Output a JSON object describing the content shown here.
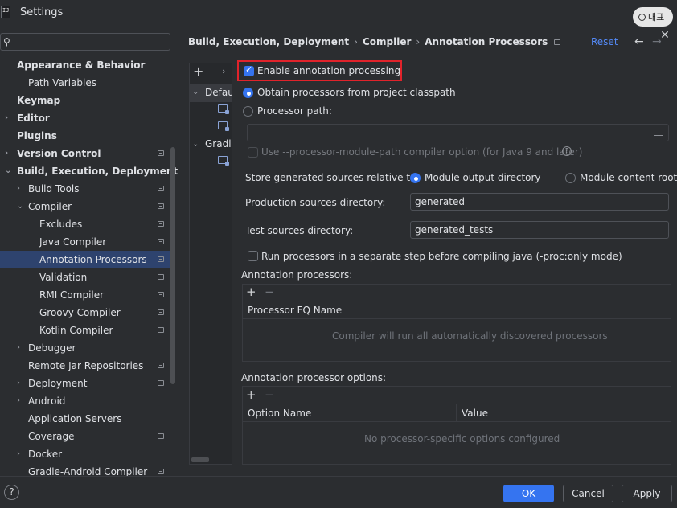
{
  "window": {
    "title": "Settings",
    "ime_label": "대표"
  },
  "sidebar": {
    "search_placeholder": "",
    "items": [
      {
        "label": "Appearance & Behavior",
        "bold": true,
        "expanded": true
      },
      {
        "label": "Path Variables"
      },
      {
        "label": "Keymap",
        "bold": true
      },
      {
        "label": "Editor",
        "bold": true
      },
      {
        "label": "Plugins",
        "bold": true
      },
      {
        "label": "Version Control",
        "bold": true
      },
      {
        "label": "Build, Execution, Deployment",
        "bold": true,
        "expanded": true
      },
      {
        "label": "Build Tools"
      },
      {
        "label": "Compiler",
        "expanded": true
      },
      {
        "label": "Excludes"
      },
      {
        "label": "Java Compiler"
      },
      {
        "label": "Annotation Processors",
        "selected": true
      },
      {
        "label": "Validation"
      },
      {
        "label": "RMI Compiler"
      },
      {
        "label": "Groovy Compiler"
      },
      {
        "label": "Kotlin Compiler"
      },
      {
        "label": "Debugger"
      },
      {
        "label": "Remote Jar Repositories"
      },
      {
        "label": "Deployment"
      },
      {
        "label": "Android"
      },
      {
        "label": "Application Servers"
      },
      {
        "label": "Coverage"
      },
      {
        "label": "Docker"
      },
      {
        "label": "Gradle-Android Compiler"
      }
    ]
  },
  "breadcrumb": {
    "part1": "Build, Execution, Deployment",
    "part2": "Compiler",
    "part3": "Annotation Processors"
  },
  "header": {
    "reset_label": "Reset"
  },
  "profiles": {
    "default_label": "Default",
    "gradle_label": "Gradle"
  },
  "form": {
    "enable_label": "Enable annotation processing",
    "enable_checked": true,
    "obtain_label": "Obtain processors from project classpath",
    "path_label": "Processor path:",
    "path_value": "",
    "module_path_label": "Use --processor-module-path compiler option (for Java 9 and later)",
    "store_label": "Store generated sources relative to:",
    "module_output_label": "Module output directory",
    "module_content_label": "Module content root",
    "prod_label": "Production sources directory:",
    "prod_value": "generated",
    "test_label": "Test sources directory:",
    "test_value": "generated_tests",
    "run_separate_label": "Run processors in a separate step before compiling java (-proc:only mode)"
  },
  "processors": {
    "section_label": "Annotation processors:",
    "column": "Processor FQ Name",
    "empty": "Compiler will run all automatically discovered processors"
  },
  "options": {
    "section_label": "Annotation processor options:",
    "col_name": "Option Name",
    "col_value": "Value",
    "empty": "No processor-specific options configured"
  },
  "footer": {
    "ok": "OK",
    "cancel": "Cancel",
    "apply": "Apply"
  },
  "colors": {
    "accent": "#3574f0",
    "link": "#548af7",
    "selection": "#2e436e",
    "highlight_border": "#e0232b",
    "background": "#2b2d30"
  }
}
